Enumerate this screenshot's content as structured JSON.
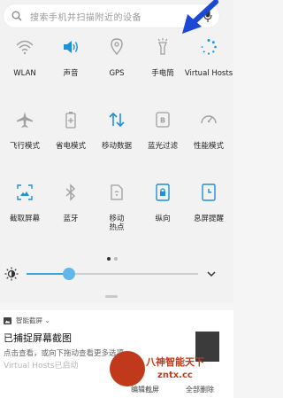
{
  "search": {
    "placeholder": "搜索手机并扫描附近的设备",
    "search_icon": "search-icon",
    "voice_icon": "mic-icon"
  },
  "tiles": [
    [
      {
        "label": "WLAN",
        "icon": "wifi-icon",
        "active": false
      },
      {
        "label": "声音",
        "icon": "volume-icon",
        "active": true
      },
      {
        "label": "GPS",
        "icon": "location-icon",
        "active": false
      },
      {
        "label": "手电筒",
        "icon": "flashlight-icon",
        "active": false
      },
      {
        "label": "Virtual Hosts",
        "icon": "loading-icon",
        "active": true
      }
    ],
    [
      {
        "label": "飞行模式",
        "icon": "airplane-icon",
        "active": false
      },
      {
        "label": "省电模式",
        "icon": "battery-saver-icon",
        "active": false
      },
      {
        "label": "移动数据",
        "icon": "mobile-data-icon",
        "active": true
      },
      {
        "label": "蓝光过滤",
        "icon": "blue-light-filter-icon",
        "active": false
      },
      {
        "label": "性能模式",
        "icon": "performance-icon",
        "active": false
      }
    ],
    [
      {
        "label": "截取屏幕",
        "icon": "screenshot-icon",
        "active": true
      },
      {
        "label": "蓝牙",
        "icon": "bluetooth-icon",
        "active": false
      },
      {
        "label": "移动\n热点",
        "icon": "hotspot-icon",
        "active": false
      },
      {
        "label": "纵向",
        "icon": "portrait-lock-icon",
        "active": true
      },
      {
        "label": "息屏提醒",
        "icon": "always-on-display-icon",
        "active": true
      }
    ]
  ],
  "page_indicator": {
    "pages": 2,
    "current": 1
  },
  "brightness": {
    "level": 0.25
  },
  "notification": {
    "app_name": "智能截屏 ⌄",
    "title": "已捕捉屏幕截图",
    "subtitle": "点击查看，或向下拖动查看更多选项",
    "line2": "Virtual Hosts已启动",
    "action_edit": "编辑截屏",
    "action_delete": "全部删除"
  },
  "watermark": {
    "line1": "八神智能天下",
    "line2": "zntx.cc"
  },
  "colors": {
    "accent": "#1e90d6",
    "inactive": "#9a9a9a",
    "arrow": "#1b49d6"
  }
}
